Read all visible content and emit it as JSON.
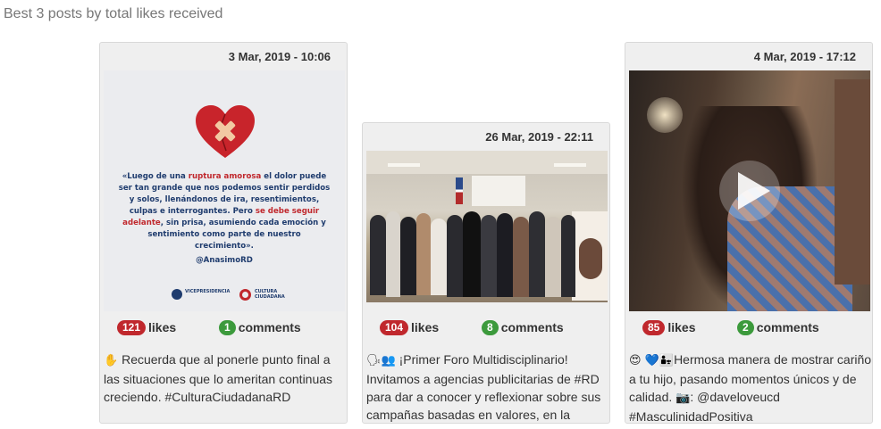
{
  "section": {
    "title": "Best 3 posts by total likes received"
  },
  "posts": [
    {
      "date": "3 Mar, 2019 - 10:06",
      "likes": "121",
      "likes_label": "likes",
      "comments": "1",
      "comments_label": "comments",
      "caption_emoji": "✋",
      "caption": "Recuerda que al ponerle punto final a las situaciones que lo ameritan continuas creciendo. #CulturaCiudadanaRD",
      "image": {
        "kind": "quote-graphic",
        "quote_line_1a": "«Luego de una ",
        "quote_line_1b": "ruptura amorosa",
        "quote_line_1c": " el dolor puede ser tan grande que nos podemos sentir perdidos y solos, llenándonos de ira, resentimientos, culpas e interrogantes. ",
        "quote_line_2a": "Pero ",
        "quote_line_2b": "se debe seguir adelante",
        "quote_line_2c": ", sin prisa, asumiendo cada emoción y sentimiento como parte de nuestro crecimiento».",
        "handle": "@AnasimoRD",
        "logo_left": "VICEPRESIDENCIA",
        "logo_right": "CULTURA CIUDADANA"
      }
    },
    {
      "date": "26 Mar, 2019 - 22:11",
      "likes": "104",
      "likes_label": "likes",
      "comments": "8",
      "comments_label": "comments",
      "caption_emoji": "🗣👥",
      "caption": "¡Primer Foro Multidisciplinario! Invitamos a agencias publicitarias de #RD para dar a conocer y reflexionar sobre sus campañas basadas en valores, en la",
      "image": {
        "kind": "group-photo"
      }
    },
    {
      "date": "4 Mar, 2019 - 17:12",
      "likes": "85",
      "likes_label": "likes",
      "comments": "2",
      "comments_label": "comments",
      "caption_emoji": "😍 💙👨‍👧",
      "caption": "Hermosa manera de mostrar cariño a tu hijo, pasando momentos únicos y de calidad.",
      "caption_camera": "📷",
      "caption_tail": ": @daveloveucd #MasculinidadPositiva",
      "image": {
        "kind": "video-still"
      }
    }
  ],
  "colors": {
    "likes_badge": "#c0282d",
    "comments_badge": "#3c9a3c"
  }
}
